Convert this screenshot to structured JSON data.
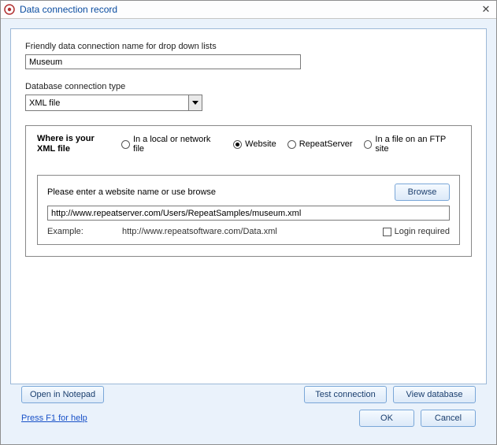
{
  "window": {
    "title": "Data connection record",
    "close_glyph": "✕"
  },
  "fields": {
    "friendly_label": "Friendly data connection name for drop down lists",
    "friendly_value": "Museum",
    "conn_type_label": "Database connection type",
    "conn_type_value": "XML file"
  },
  "location": {
    "heading": "Where is your XML file",
    "options": {
      "local": "In a local or network file",
      "website": "Website",
      "repeatserver": "RepeatServer",
      "ftp": "In a file on an FTP site"
    },
    "selected": "website"
  },
  "url_section": {
    "prompt": "Please enter a website name or use browse",
    "browse_label": "Browse",
    "url_value": "http://www.repeatserver.com/Users/RepeatSamples/museum.xml",
    "example_label": "Example:",
    "example_url": "http://www.repeatsoftware.com/Data.xml",
    "login_required_label": "Login required",
    "login_required_checked": false
  },
  "buttons": {
    "open_notepad": "Open in Notepad",
    "test_connection": "Test connection",
    "view_database": "View database",
    "ok": "OK",
    "cancel": "Cancel"
  },
  "help_link": "Press F1 for help"
}
